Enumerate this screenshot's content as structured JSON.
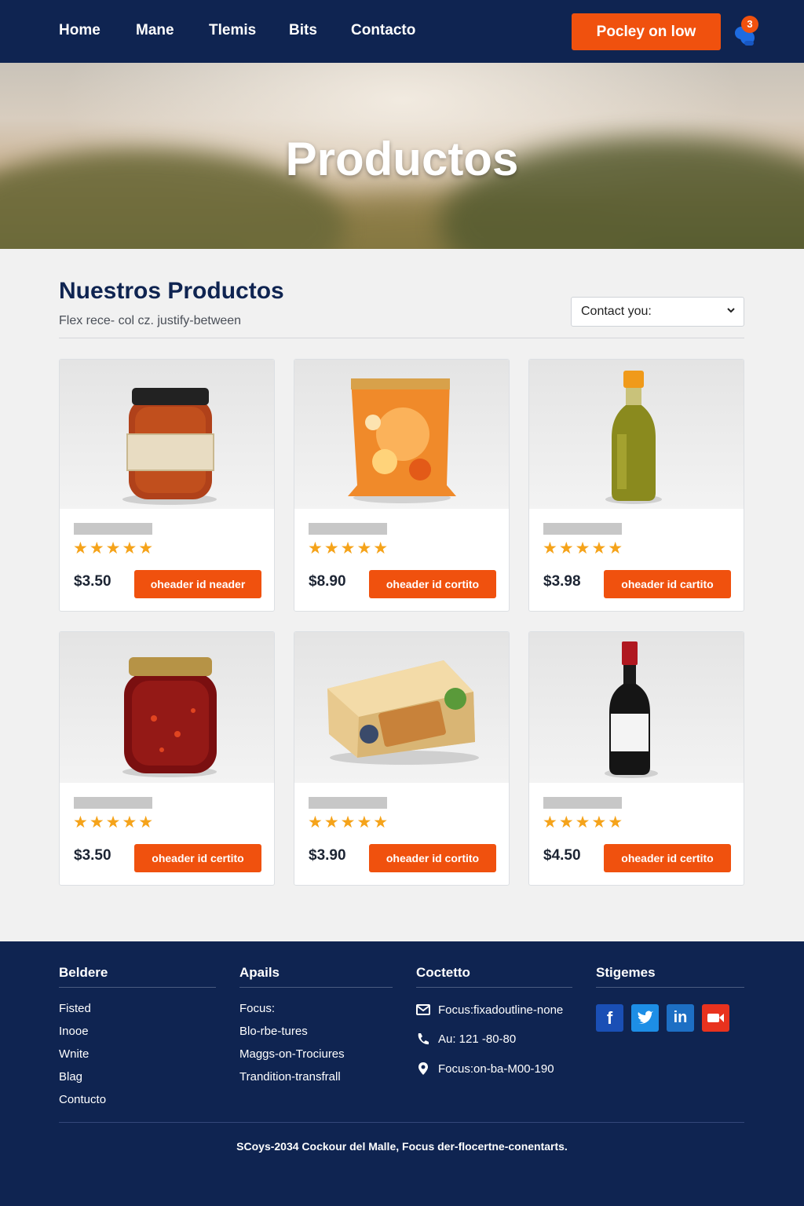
{
  "nav": {
    "links": [
      "Home",
      "Mane",
      "Tlemis",
      "Bits",
      "Contacto"
    ],
    "cta_label": "Pocley on low",
    "cart_count": "3"
  },
  "hero": {
    "title": "Productos"
  },
  "section": {
    "title": "Nuestros Productos",
    "subtitle": "Flex rece- col cz. justify-between",
    "select_value": "Contact you:"
  },
  "products": [
    {
      "image": "sauce-jar",
      "stars": "★★★★★",
      "rating": 5,
      "price": "$3.50",
      "button": "oheader id neader"
    },
    {
      "image": "snack-bag",
      "stars": "★★★★★",
      "rating": 5,
      "price": "$8.90",
      "button": "oheader id cortito"
    },
    {
      "image": "olive-oil-bottle",
      "stars": "★★★★★",
      "rating": 5,
      "price": "$3.98",
      "button": "oheader id cartito"
    },
    {
      "image": "jam-jar",
      "stars": "★★★★★",
      "rating": 5,
      "price": "$3.50",
      "button": "oheader id certito"
    },
    {
      "image": "food-package",
      "stars": "★★★★★",
      "rating": 5,
      "price": "$3.90",
      "button": "oheader id cortito"
    },
    {
      "image": "wine-bottle",
      "stars": "★★★★★",
      "rating": 5,
      "price": "$4.50",
      "button": "oheader id certito"
    }
  ],
  "footer": {
    "col1": {
      "title": "Beldere",
      "links": [
        "Fisted",
        "Inooe",
        "Wnite",
        "Blag",
        "Contucto"
      ]
    },
    "col2": {
      "title": "Apails",
      "links": [
        "Focus:",
        "Blo-rbe-tures",
        "Maggs-on-Trociures",
        "Trandition-transfrall"
      ]
    },
    "col3": {
      "title": "Coctetto",
      "email": "Focus:fixadoutline-none",
      "phone": "Au: 121 -80-80",
      "address": "Focus:on-ba-M00-190"
    },
    "col4": {
      "title": "Stigemes",
      "social": [
        "facebook-icon",
        "twitter-icon",
        "linkedin-icon",
        "video-icon"
      ]
    },
    "copyright": "SCoys-2034 Cockour del Malle, Focus der-flocertne-conentarts."
  },
  "colors": {
    "navy": "#0f2451",
    "accent": "#f0510e",
    "star": "#f5a31a"
  }
}
